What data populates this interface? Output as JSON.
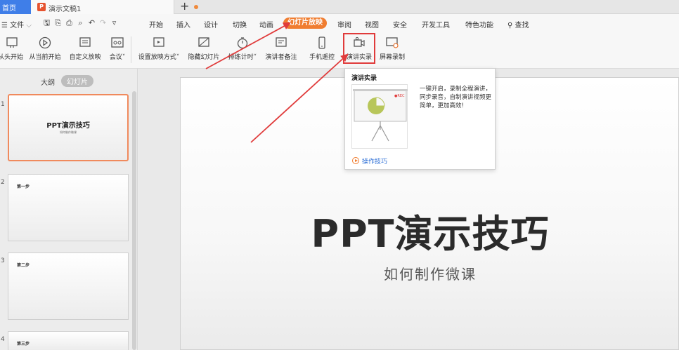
{
  "tabs": {
    "home": "首页",
    "document": "演示文稿1",
    "new_tab": "+"
  },
  "menu": {
    "file": "文件",
    "items": [
      "开始",
      "插入",
      "设计",
      "切换",
      "动画",
      "幻灯片放映",
      "审阅",
      "视图",
      "安全",
      "开发工具",
      "特色功能"
    ],
    "search": "查找"
  },
  "ribbon": {
    "from_start": "从头开始",
    "from_current": "从当前开始",
    "custom_show": "自定义放映",
    "meeting": "会议",
    "setup_show": "设置放映方式",
    "hide_slide": "隐藏幻灯片",
    "rehearse_timing": "排练计时",
    "presenter_notes": "演讲者备注",
    "phone_remote": "手机遥控",
    "record_presentation": "演讲实录",
    "screen_record": "屏幕录制"
  },
  "left_panel": {
    "outline_tab": "大纲",
    "slides_tab": "幻灯片",
    "slides": [
      {
        "num": "1",
        "title": "PPT演示技巧",
        "subtitle": "如何制作微课"
      },
      {
        "num": "2",
        "title": "第一步"
      },
      {
        "num": "3",
        "title": "第二步"
      },
      {
        "num": "4",
        "title": "第三步"
      }
    ]
  },
  "slide": {
    "title": "PPT演示技巧",
    "subtitle": "如何制作微课"
  },
  "tooltip": {
    "title": "演讲实录",
    "description": "一键开启，录制全程演讲，同步录音，自制演讲视频更简单，更加高效!",
    "rec_badge": "●REC",
    "link": "操作技巧"
  },
  "colors": {
    "accent_orange": "#f07d30",
    "highlight_red": "#e03b3b",
    "home_tab_blue": "#3f7ee8"
  }
}
